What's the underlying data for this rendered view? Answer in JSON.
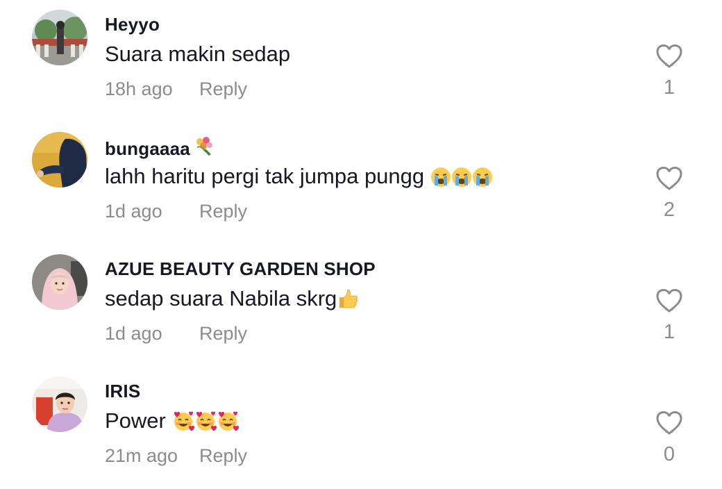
{
  "comments": [
    {
      "username": "Heyyo",
      "badge": "",
      "text": "Suara makin sedap",
      "emojis": [],
      "time": "18h ago",
      "reply_label": "Reply",
      "likes": "1"
    },
    {
      "username": "bungaaaa",
      "badge": "bouquet-emoji",
      "text": "lahh haritu pergi tak jumpa pungg",
      "emojis": [
        "crying-face-emoji",
        "crying-face-emoji",
        "crying-face-emoji"
      ],
      "time": "1d ago",
      "reply_label": "Reply",
      "likes": "2"
    },
    {
      "username": "AZUE BEAUTY GARDEN SHOP",
      "badge": "",
      "text": "sedap suara Nabila skrg",
      "emojis": [
        "thumbs-up-emoji"
      ],
      "time": "1d ago",
      "reply_label": "Reply",
      "likes": "1"
    },
    {
      "username": "IRIS",
      "badge": "",
      "text": "Power",
      "emojis": [
        "smiling-face-with-hearts-emoji",
        "smiling-face-with-hearts-emoji",
        "smiling-face-with-hearts-emoji"
      ],
      "time": "21m ago",
      "reply_label": "Reply",
      "likes": "0"
    }
  ],
  "colors": {
    "primary_text": "#161823",
    "secondary_text": "#8a8b91",
    "background": "#ffffff"
  }
}
